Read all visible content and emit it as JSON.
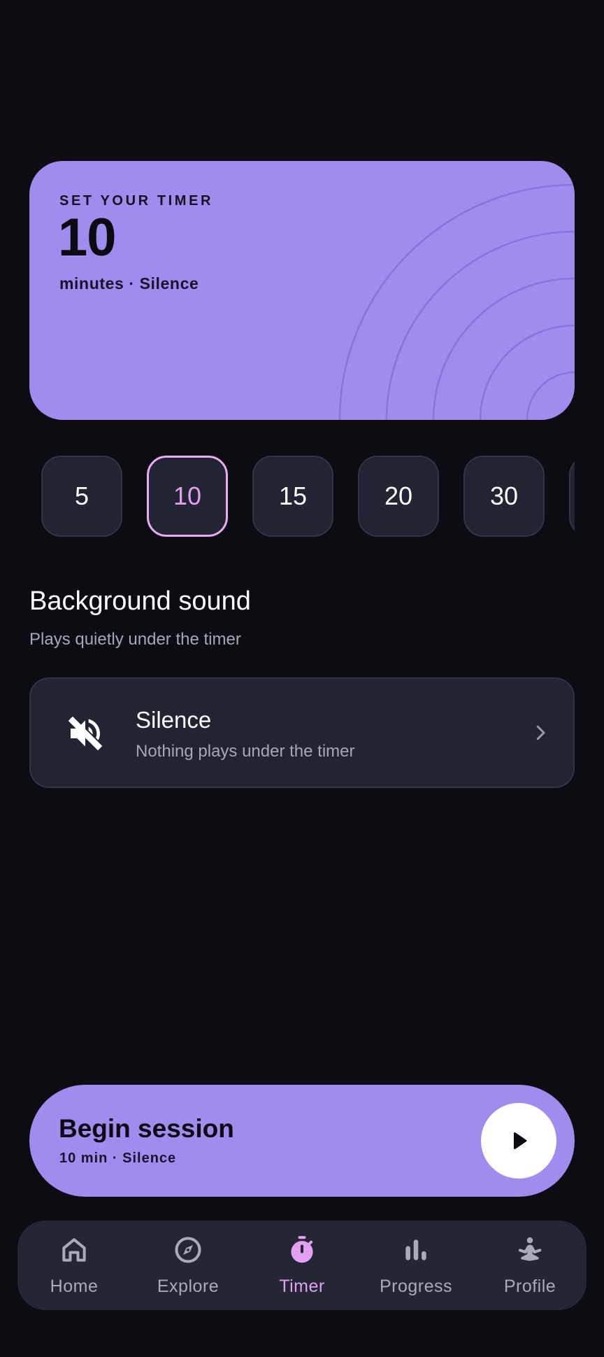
{
  "hero": {
    "eyebrow": "SET YOUR TIMER",
    "value": "10",
    "caption": "minutes · Silence"
  },
  "durations": {
    "options": [
      "5",
      "10",
      "15",
      "20",
      "30"
    ],
    "selected": "10"
  },
  "background_sound": {
    "title": "Background sound",
    "subtitle": "Plays quietly under the timer",
    "current": {
      "name": "Silence",
      "description": "Nothing plays under the timer",
      "icon": "volume-off-icon"
    }
  },
  "cta": {
    "title": "Begin session",
    "subtitle": "10 min · Silence",
    "icon": "play-icon"
  },
  "nav": {
    "items": [
      {
        "label": "Home",
        "icon": "home-icon",
        "active": false
      },
      {
        "label": "Explore",
        "icon": "compass-icon",
        "active": false
      },
      {
        "label": "Timer",
        "icon": "stopwatch-icon",
        "active": true
      },
      {
        "label": "Progress",
        "icon": "bar-chart-icon",
        "active": false
      },
      {
        "label": "Profile",
        "icon": "meditation-icon",
        "active": false
      }
    ]
  },
  "colors": {
    "background": "#0c0d12",
    "accent": "#a08bee",
    "active": "#e3a0f0",
    "surface": "#212433"
  }
}
